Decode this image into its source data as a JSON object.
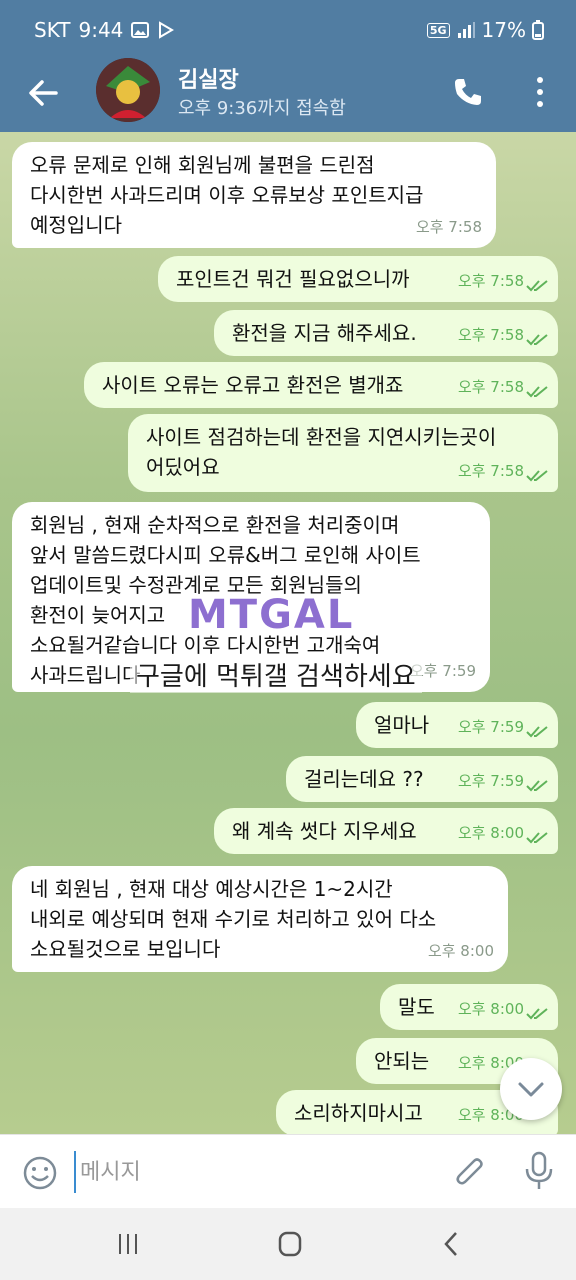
{
  "status_bar": {
    "carrier": "SKT",
    "time": "9:44",
    "network": "5G",
    "battery": "17%"
  },
  "header": {
    "name": "김실장",
    "last_seen": "오후 9:36까지 접속함"
  },
  "messages": [
    {
      "dir": "in",
      "text": "오류 문제로 인해 회원님께 불편을 드린점\n다시한번 사과드리며 이후 오류보상 포인트지급\n예정입니다",
      "time": "오후 7:58"
    },
    {
      "dir": "out",
      "text": "포인트건 뭐건 필요없으니까",
      "time": "오후 7:58"
    },
    {
      "dir": "out",
      "text": "환전을 지금 해주세요.",
      "time": "오후 7:58"
    },
    {
      "dir": "out",
      "text": "사이트 오류는 오류고 환전은 별개죠",
      "time": "오후 7:58"
    },
    {
      "dir": "out",
      "text": "사이트 점검하는데 환전을 지연시키는곳이\n어딨어요",
      "time": "오후 7:58"
    },
    {
      "dir": "in",
      "text": "회원님 , 현재 순차적으로 환전을 처리중이며\n앞서 말씀드렸다시피 오류&버그 로인해 사이트\n업데이트및 수정관계로 모든 회원님들의\n환전이 늦어지고 ",
      "text_tail": "소요될거같습니다 이후 다시한번 고개숙여\n사과드립니다",
      "time": "오후 7:59"
    },
    {
      "dir": "out",
      "text": "얼마나",
      "time": "오후 7:59"
    },
    {
      "dir": "out",
      "text": "걸리는데요 ??",
      "time": "오후 7:59"
    },
    {
      "dir": "out",
      "text": "왜 계속 썻다 지우세요",
      "time": "오후 8:00"
    },
    {
      "dir": "in",
      "text": "네 회원님 , 현재 대상 예상시간은 1~2시간\n내외로 예상되며 현재 수기로 처리하고 있어 다소\n소요될것으로 보입니다",
      "time": "오후 8:00"
    },
    {
      "dir": "out",
      "text": "말도",
      "time": "오후 8:00"
    },
    {
      "dir": "out",
      "text": "안되는",
      "time": "오후 8:00"
    },
    {
      "dir": "out",
      "text": "소리하지마시고",
      "time": "오후 8:00"
    }
  ],
  "watermark": {
    "logo": "MTGAL",
    "caption": "구글에 먹튀갤 검색하세요"
  },
  "input": {
    "placeholder": "메시지"
  },
  "icons": [
    "arrow-back-icon",
    "phone-icon",
    "more-vert-icon",
    "emoji-icon",
    "attach-icon",
    "mic-icon",
    "chevron-down-icon",
    "double-check-icon"
  ]
}
